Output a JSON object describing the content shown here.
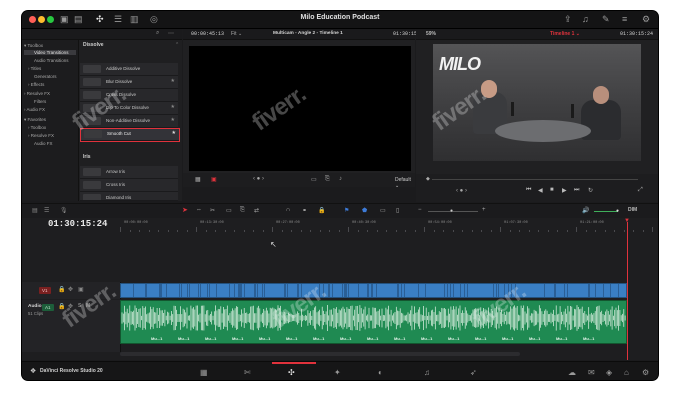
{
  "app": {
    "project_title": "Milo Education Podcast",
    "product_name": "DaVinci Resolve Studio 20"
  },
  "effects_tree": {
    "items": [
      {
        "label": "Toolbox",
        "expanded": true
      },
      {
        "label": "Video Transitions",
        "selected": true
      },
      {
        "label": "Audio Transitions"
      },
      {
        "label": "Titles"
      },
      {
        "label": "Generators"
      },
      {
        "label": "Effects"
      },
      {
        "label": "Resolve FX"
      },
      {
        "label": "Filters"
      },
      {
        "label": "Audio FX"
      },
      {
        "label": "Favorites"
      },
      {
        "label": "Toolbox"
      },
      {
        "label": "Resolve FX"
      },
      {
        "label": "Audio FX"
      }
    ]
  },
  "effects_list": {
    "section_dissolve": "Dissolve",
    "section_iris": "Iris",
    "dissolve_items": [
      {
        "label": "Additive Dissolve"
      },
      {
        "label": "Blur Dissolve"
      },
      {
        "label": "Cross Dissolve"
      },
      {
        "label": "Dip To Color Dissolve"
      },
      {
        "label": "Non-Additive Dissolve"
      },
      {
        "label": "Smooth Cut",
        "highlighted": true
      }
    ],
    "iris_items": [
      {
        "label": "Arrow Iris"
      },
      {
        "label": "Cross Iris"
      },
      {
        "label": "Diamond Iris"
      }
    ]
  },
  "source_viewer": {
    "timecode_left": "00:00:45:13",
    "fit_label": "Fit",
    "clip_name": "Multicam - Angle 2 - Timeline 1",
    "timecode_right": "01:30:15:24",
    "mode_label": "Default"
  },
  "timeline_viewer": {
    "zoom": "59%",
    "timecode_left": "01:30:15:24",
    "timeline_name": "Timeline 1",
    "timecode_right": "01:30:15:24",
    "brand_text": "MILO"
  },
  "timeline": {
    "current_timecode": "01:30:15:24",
    "ruler_labels": [
      "00:00:00:00",
      "00:13:30:00",
      "00:27:00:00",
      "00:40:30:00",
      "00:54:00:00",
      "01:07:30:00",
      "01:21:00:00"
    ],
    "audio_level_label": "DIM",
    "video_track": {
      "label": "V1"
    },
    "audio_track": {
      "label": "Audio 1",
      "sub": "51 Clips",
      "badge": "A1"
    },
    "clip_labels": [
      "Mu...1",
      "Mu...1",
      "Mu...1",
      "Mu...1",
      "Mu...1",
      "Mu...1",
      "Mu...1",
      "Mu...1",
      "Mu...1",
      "Mu...1",
      "Mu...1",
      "Mu...1",
      "Mu...1",
      "Mu...1",
      "Mu...1",
      "Mu...1",
      "Mu...1"
    ],
    "clip_label_single": "Mu...1"
  },
  "watermark": "fiverr."
}
